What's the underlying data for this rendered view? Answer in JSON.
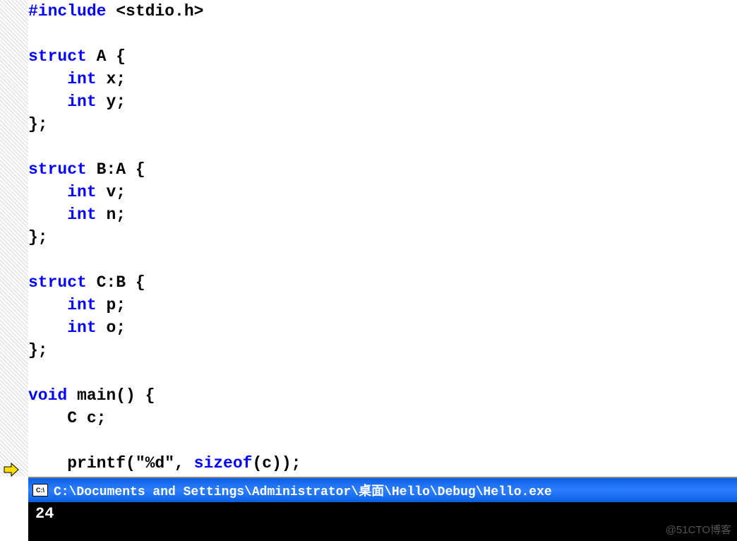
{
  "code": {
    "lines": [
      {
        "tokens": [
          {
            "t": "#include",
            "c": "kw-preprocessor"
          },
          {
            "t": " <stdio.h>",
            "c": "txt"
          }
        ]
      },
      {
        "tokens": []
      },
      {
        "tokens": [
          {
            "t": "struct",
            "c": "kw-blue"
          },
          {
            "t": " A {",
            "c": "txt"
          }
        ]
      },
      {
        "tokens": [
          {
            "t": "    ",
            "c": "txt"
          },
          {
            "t": "int",
            "c": "kw-blue"
          },
          {
            "t": " x;",
            "c": "txt"
          }
        ]
      },
      {
        "tokens": [
          {
            "t": "    ",
            "c": "txt"
          },
          {
            "t": "int",
            "c": "kw-blue"
          },
          {
            "t": " y;",
            "c": "txt"
          }
        ]
      },
      {
        "tokens": [
          {
            "t": "};",
            "c": "txt"
          }
        ]
      },
      {
        "tokens": []
      },
      {
        "tokens": [
          {
            "t": "struct",
            "c": "kw-blue"
          },
          {
            "t": " B:A {",
            "c": "txt"
          }
        ]
      },
      {
        "tokens": [
          {
            "t": "    ",
            "c": "txt"
          },
          {
            "t": "int",
            "c": "kw-blue"
          },
          {
            "t": " v;",
            "c": "txt"
          }
        ]
      },
      {
        "tokens": [
          {
            "t": "    ",
            "c": "txt"
          },
          {
            "t": "int",
            "c": "kw-blue"
          },
          {
            "t": " n;",
            "c": "txt"
          }
        ]
      },
      {
        "tokens": [
          {
            "t": "};",
            "c": "txt"
          }
        ]
      },
      {
        "tokens": []
      },
      {
        "tokens": [
          {
            "t": "struct",
            "c": "kw-blue"
          },
          {
            "t": " C:B {",
            "c": "txt"
          }
        ]
      },
      {
        "tokens": [
          {
            "t": "    ",
            "c": "txt"
          },
          {
            "t": "int",
            "c": "kw-blue"
          },
          {
            "t": " p;",
            "c": "txt"
          }
        ]
      },
      {
        "tokens": [
          {
            "t": "    ",
            "c": "txt"
          },
          {
            "t": "int",
            "c": "kw-blue"
          },
          {
            "t": " o;",
            "c": "txt"
          }
        ]
      },
      {
        "tokens": [
          {
            "t": "};",
            "c": "txt"
          }
        ]
      },
      {
        "tokens": []
      },
      {
        "tokens": [
          {
            "t": "void",
            "c": "kw-blue"
          },
          {
            "t": " main() {",
            "c": "txt"
          }
        ]
      },
      {
        "tokens": [
          {
            "t": "    C c;",
            "c": "txt"
          }
        ]
      },
      {
        "tokens": []
      },
      {
        "tokens": [
          {
            "t": "    printf(\"%d\", ",
            "c": "txt"
          },
          {
            "t": "sizeof",
            "c": "kw-blue"
          },
          {
            "t": "(c));",
            "c": "txt"
          }
        ]
      }
    ]
  },
  "console": {
    "icon_text": "C:\\",
    "title": "C:\\Documents and Settings\\Administrator\\桌面\\Hello\\Debug\\Hello.exe",
    "output": "24"
  },
  "watermark": "@51CTO博客"
}
